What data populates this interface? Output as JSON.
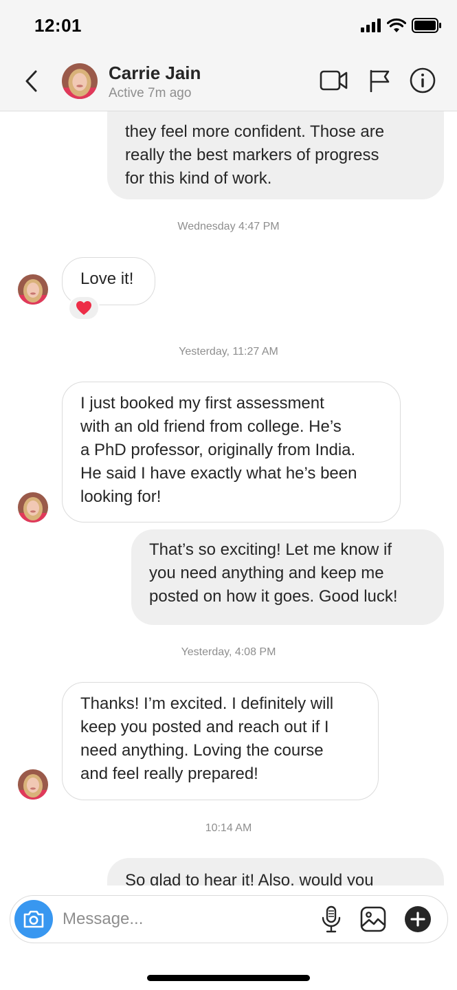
{
  "status_bar": {
    "time": "12:01",
    "icons": [
      "cellular-signal-icon",
      "wifi-icon",
      "battery-icon"
    ]
  },
  "header": {
    "back_icon": "chevron-left-icon",
    "contact_name": "Carrie Jain",
    "contact_status": "Active 7m ago",
    "actions": [
      "video-call-icon",
      "flag-icon",
      "info-icon"
    ]
  },
  "conversation": {
    "items": [
      {
        "kind": "outgoing",
        "text": "they feel more confident.  Those are\nreally the best markers of progress\nfor this kind of work."
      },
      {
        "kind": "timestamp",
        "text": "Wednesday 4:47 PM"
      },
      {
        "kind": "incoming",
        "text": "Love it!",
        "reaction": "❤️"
      },
      {
        "kind": "timestamp",
        "text": "Yesterday, 11:27 AM"
      },
      {
        "kind": "incoming",
        "text": "I just booked my first assessment\nwith an old friend from college. He’s\na PhD professor, originally from India.\nHe said I have exactly what he’s been\nlooking for!"
      },
      {
        "kind": "outgoing",
        "text": "That’s so exciting!  Let me know if\nyou need anything and keep me\nposted on how it goes.  Good luck!"
      },
      {
        "kind": "timestamp",
        "text": "Yesterday, 4:08 PM"
      },
      {
        "kind": "incoming",
        "text": "Thanks! I’m excited. I definitely will\nkeep you posted and reach out if I\nneed anything. Loving the course\nand feel really prepared!"
      },
      {
        "kind": "timestamp",
        "text": "10:14 AM"
      },
      {
        "kind": "outgoing",
        "text": "So glad to hear it!  Also, would you"
      }
    ]
  },
  "composer": {
    "placeholder": "Message...",
    "camera_icon": "camera-icon",
    "actions": [
      "microphone-icon",
      "gallery-icon",
      "plus-icon"
    ]
  },
  "colors": {
    "accent": "#3897f0",
    "bar_background": "#f5f5f5",
    "outgoing_bubble": "#efefef",
    "bubble_border": "#dbdbdb",
    "secondary_text": "#8e8e8e",
    "primary_text": "#262626",
    "reaction_heart": "#ed2d47"
  }
}
